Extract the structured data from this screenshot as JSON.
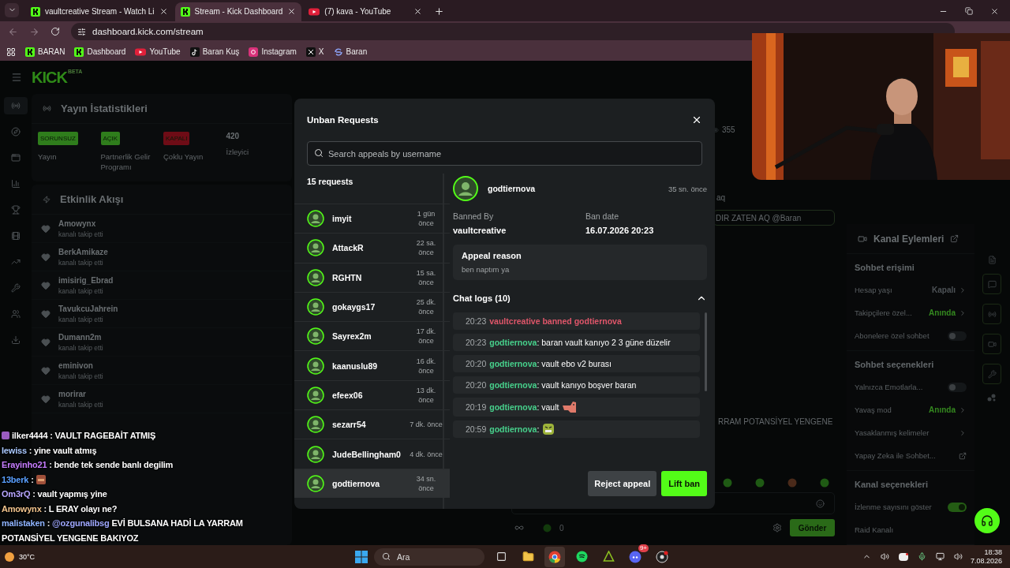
{
  "browser": {
    "tabs": [
      {
        "title": "vaultcreative Stream - Watch Li",
        "selected": false
      },
      {
        "title": "Stream - Kick Dashboard",
        "selected": true
      },
      {
        "title": "(7) kava - YouTube",
        "selected": false
      }
    ],
    "address": "dashboard.kick.com/stream",
    "bookmarks": [
      {
        "label": "BARAN"
      },
      {
        "label": "Dashboard"
      },
      {
        "label": "YouTube"
      },
      {
        "label": "Baran Kuş"
      },
      {
        "label": "Instagram"
      },
      {
        "label": "X"
      },
      {
        "label": "Baran"
      }
    ]
  },
  "dashboard": {
    "logo": "KICK",
    "logo_tag": "BETA",
    "sidebar": [
      {
        "selected": true
      },
      {
        "selected": false
      },
      {
        "selected": false
      },
      {
        "selected": false
      },
      {
        "selected": false
      },
      {
        "selected": false
      },
      {
        "selected": false
      },
      {
        "selected": false
      },
      {
        "selected": false
      },
      {
        "selected": false
      }
    ],
    "stats": {
      "title": "Yayın İstatistikleri",
      "items": [
        {
          "kind": "badge",
          "badge": "SORUNSUZ",
          "color": "#2f7d1c",
          "label": "Yayın"
        },
        {
          "kind": "badge",
          "badge": "AÇIK",
          "color": "#2f7d1c",
          "label": "Partnerlik Gelir Programı"
        },
        {
          "kind": "badge",
          "badge": "KAPALI",
          "color": "#6e0c16",
          "label": "Çoklu Yayın"
        },
        {
          "kind": "count",
          "value": "420",
          "label": "İzleyici"
        }
      ]
    },
    "events": {
      "title": "Etkinlik Akışı",
      "items": [
        {
          "name": "Amowynx",
          "action": "kanalı takip etti"
        },
        {
          "name": "BerkAmikaze",
          "action": "kanalı takip etti"
        },
        {
          "name": "imisirig_Ebrad",
          "action": "kanalı takip etti"
        },
        {
          "name": "TavukcuJahrein",
          "action": "kanalı takip etti"
        },
        {
          "name": "Dumann2m",
          "action": "kanalı takip etti"
        },
        {
          "name": "eminivon",
          "action": "kanalı takip etti"
        },
        {
          "name": "morirar",
          "action": "kanalı takip etti"
        }
      ]
    },
    "chat": {
      "viewers": "355",
      "line": "aq",
      "pinned": "DIR ZATEN AQ @Baran",
      "message": "RRAM POTANSİYEL YENGENE",
      "count": "0",
      "send": "Gönder"
    },
    "channel_actions": {
      "title": "Kanal Eylemleri",
      "sections": [
        {
          "title": "Sohbet erişimi",
          "rows": [
            {
              "kind": "link",
              "label": "Hesap yaşı",
              "value": "Kapalı",
              "color": "#4d5256"
            },
            {
              "kind": "link",
              "label": "Takipçilere özel...",
              "value": "Anında",
              "color": "#34881f"
            },
            {
              "kind": "toggle",
              "label": "Abonelere özel sohbet",
              "on": false
            }
          ]
        },
        {
          "title": "Sohbet seçenekleri",
          "rows": [
            {
              "kind": "toggle",
              "label": "Yalnızca Emotlarla...",
              "on": false
            },
            {
              "kind": "link",
              "label": "Yavaş mod",
              "value": "Anında",
              "color": "#34881f"
            },
            {
              "kind": "link",
              "label": "Yasaklanmış kelimeler"
            },
            {
              "kind": "external",
              "label": "Yapay Zeka ile Sohbet..."
            }
          ]
        },
        {
          "title": "Kanal seçenekleri",
          "rows": [
            {
              "kind": "toggle",
              "label": "İzlenme sayısını göster",
              "on": true
            },
            {
              "kind": "plain",
              "label": "Raid Kanalı"
            }
          ]
        }
      ]
    }
  },
  "modal": {
    "title": "Unban Requests",
    "search_placeholder": "Search appeals by username",
    "count": "15 requests",
    "requests": [
      {
        "name": "imyit",
        "time": "1 gün önce",
        "selected": false
      },
      {
        "name": "AttackR",
        "time": "22 sa. önce",
        "selected": false
      },
      {
        "name": "RGHTN",
        "time": "15 sa. önce",
        "selected": false
      },
      {
        "name": "gokaygs17",
        "time": "25 dk. önce",
        "selected": false
      },
      {
        "name": "Sayrex2m",
        "time": "17 dk. önce",
        "selected": false
      },
      {
        "name": "kaanuslu89",
        "time": "16 dk. önce",
        "selected": false
      },
      {
        "name": "efeex06",
        "time": "13 dk. önce",
        "selected": false
      },
      {
        "name": "sezarr54",
        "time": "7 dk. önce",
        "selected": false
      },
      {
        "name": "JudeBellingham0",
        "time": "4 dk. önce",
        "selected": false
      },
      {
        "name": "godtiernova",
        "time": "34 sn. önce",
        "selected": true
      }
    ],
    "detail": {
      "name": "godtiernova",
      "time": "35 sn. önce",
      "banned_by_label": "Banned By",
      "banned_by": "vaultcreative",
      "date_label": "Ban date",
      "date": "16.07.2026 20:23",
      "reason_title": "Appeal reason",
      "reason": "ben naptım ya",
      "logs_title": "Chat logs (10)",
      "expanded": true,
      "logs": [
        {
          "kind": "ban",
          "time": "20:23",
          "text": "vaultcreative banned godtiernova"
        },
        {
          "kind": "message",
          "time": "20:23",
          "user": "godtiernova",
          "text": ": baran vault kanıyo 2 3 güne düzelir"
        },
        {
          "kind": "message",
          "time": "20:20",
          "user": "godtiernova",
          "text": ": vault ebo v2 burası"
        },
        {
          "kind": "message",
          "time": "20:20",
          "user": "godtiernova",
          "text": ": vault kanıyo boşver baran"
        },
        {
          "kind": "emote",
          "time": "20:19",
          "user": "godtiernova",
          "text": ": vault"
        },
        {
          "kind": "emote",
          "time": "20:59",
          "user": "godtiernova",
          "text": ":"
        }
      ]
    },
    "reject": "Reject appeal",
    "lift": "Lift ban"
  },
  "overlay_chat": [
    {
      "user": "ilker4444",
      "color": "#ffffff",
      "badge": true,
      "text": " : VAULT RAGEBAİT ATMIŞ"
    },
    {
      "user": "lewiss",
      "color": "#a9c8ff",
      "badge": false,
      "text": " : yine vault atmış"
    },
    {
      "user": "Erayinho21",
      "color": "#c77dff",
      "badge": false,
      "text": " : bende tek sende banlı degilim"
    },
    {
      "user": "13berk",
      "color": "#5aa0ff",
      "badge": false,
      "text": " :",
      "emote": true
    },
    {
      "user": "Om3rQ",
      "color": "#b8a6ff",
      "badge": false,
      "text": " : vault yapmış yine"
    },
    {
      "user": "Amowynx",
      "color": "#f2c48d",
      "badge": false,
      "text": " : L ERAY olayı ne?"
    },
    {
      "user": "malistaken",
      "color": "#8fb4ff",
      "badge": false,
      "text": " : ",
      "mention": "@ozgunalibsg",
      "rest": " EVİ BULSANA HADİ LA YARRAM POTANSİYEL YENGENE BAKIYOZ"
    }
  ],
  "taskbar": {
    "weather": "30°C",
    "search": "Ara",
    "discord_badge": "9+",
    "time": "18:38",
    "date": "7.08.2026"
  }
}
